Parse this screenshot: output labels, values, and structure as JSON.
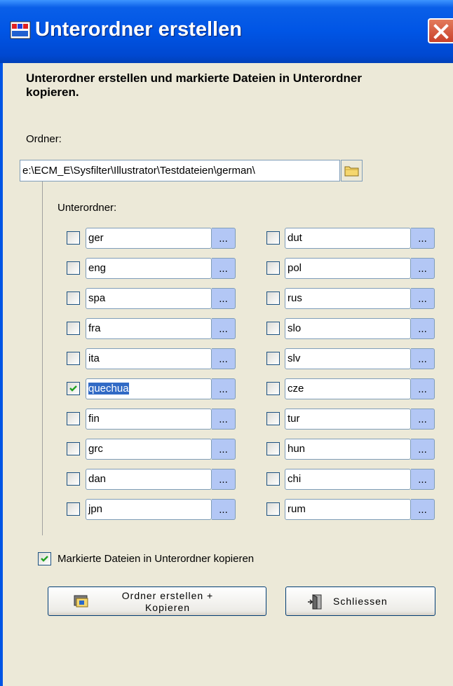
{
  "window": {
    "title": "Unterordner erstellen",
    "close_label": "X"
  },
  "description": "Unterordner erstellen und markierte Dateien in Unterordner kopieren.",
  "folder": {
    "label": "Ordner:",
    "path": "e:\\ECM_E\\Sysfilter\\Illustrator\\Testdateien\\german\\"
  },
  "subfolders": {
    "label": "Unterordner:",
    "browse_label": "...",
    "left": [
      {
        "name": "ger",
        "checked": false
      },
      {
        "name": "eng",
        "checked": false
      },
      {
        "name": "spa",
        "checked": false
      },
      {
        "name": "fra",
        "checked": false
      },
      {
        "name": "ita",
        "checked": false
      },
      {
        "name": "quechua",
        "checked": true
      },
      {
        "name": "fin",
        "checked": false
      },
      {
        "name": "grc",
        "checked": false
      },
      {
        "name": "dan",
        "checked": false
      },
      {
        "name": "jpn",
        "checked": false
      }
    ],
    "right": [
      {
        "name": "dut",
        "checked": false
      },
      {
        "name": "pol",
        "checked": false
      },
      {
        "name": "rus",
        "checked": false
      },
      {
        "name": "slo",
        "checked": false
      },
      {
        "name": "slv",
        "checked": false
      },
      {
        "name": "cze",
        "checked": false
      },
      {
        "name": "tur",
        "checked": false
      },
      {
        "name": "hun",
        "checked": false
      },
      {
        "name": "chi",
        "checked": false
      },
      {
        "name": "rum",
        "checked": false
      }
    ]
  },
  "copy_option": {
    "label": "Markierte Dateien in Unterordner kopieren",
    "checked": true
  },
  "buttons": {
    "create_line1": "Ordner erstellen +",
    "create_line2": "Kopieren",
    "close": "Schliessen"
  },
  "colors": {
    "title_bar": "#0055e5",
    "dialog_bg": "#ece9d8",
    "browse_button": "#b3c7f5",
    "selection": "#316ac5"
  }
}
